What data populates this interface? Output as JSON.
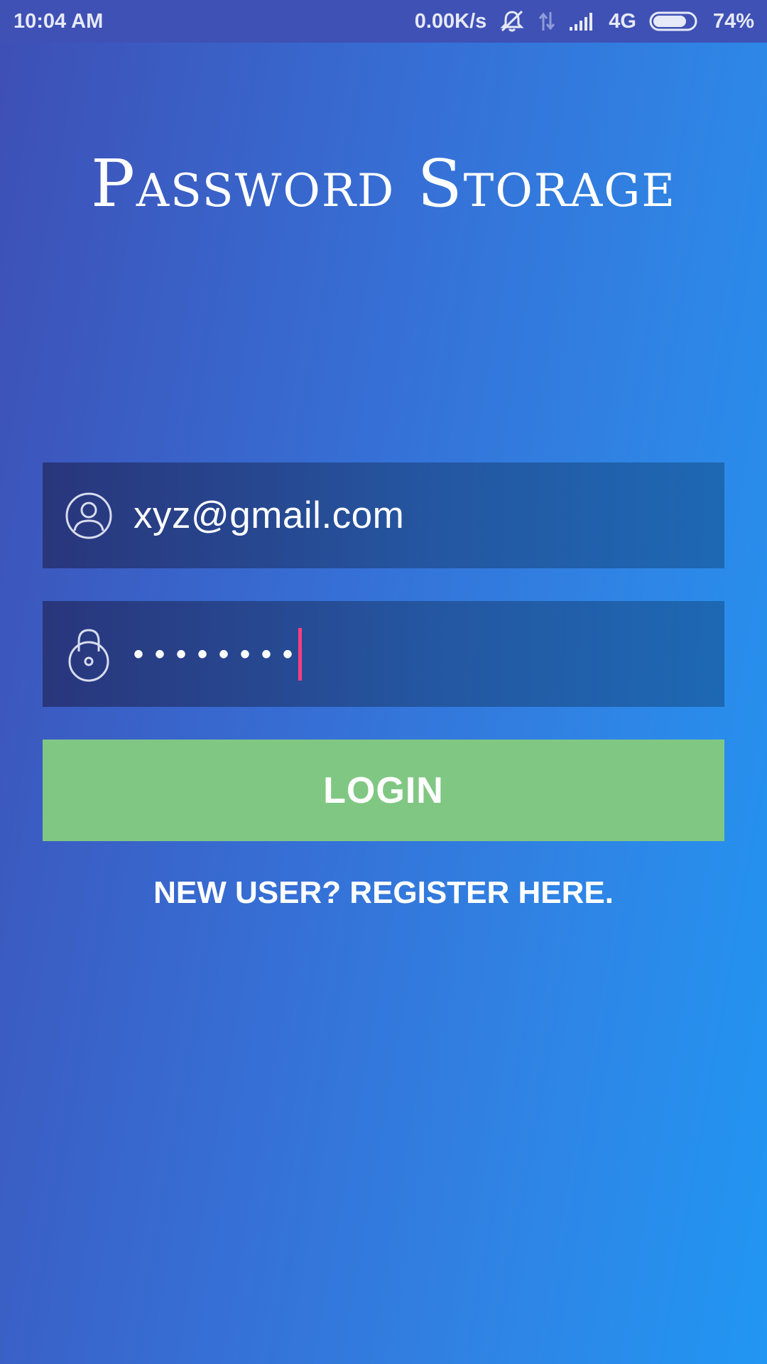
{
  "status_bar": {
    "time": "10:04 AM",
    "network_speed": "0.00K/s",
    "network_type": "4G",
    "battery_percent": "74%",
    "battery_level": 0.74,
    "icons": [
      "mute-bell-icon",
      "data-arrows-icon",
      "signal-bars-icon",
      "battery-icon"
    ]
  },
  "app": {
    "title": "Password Storage"
  },
  "form": {
    "email": {
      "icon": "user-circle-icon",
      "value": "xyz@gmail.com"
    },
    "password": {
      "icon": "lock-icon",
      "masked_value": "••••••••"
    },
    "login_label": "LOGIN",
    "register_label": "NEW USER? REGISTER HERE."
  },
  "colors": {
    "status_bar": "#3f51b5",
    "login_button": "#81c784",
    "caret": "#ff3d7f"
  }
}
